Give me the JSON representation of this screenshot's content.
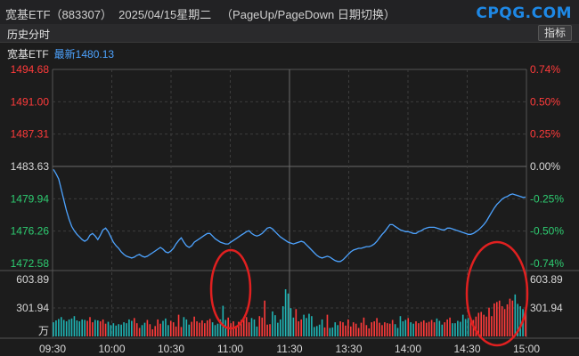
{
  "header": {
    "title": "宽基ETF（883307）  2025/04/15星期二   （PageUp/PageDown 日期切换）",
    "logo": "CPQG.COM"
  },
  "tabbar": {
    "tab_label": "历史分时",
    "indicator_button": "指标"
  },
  "info": {
    "name": "宽基ETF",
    "latest": "最新1480.13"
  },
  "colors": {
    "up": "#ff3b3b",
    "down": "#2ecc71",
    "neutral": "#d8d8d8",
    "line": "#4da3ff",
    "volume_down": "#1fb5b5",
    "annotation": "#e02020"
  },
  "chart_data": {
    "type": "line",
    "price_axis": {
      "left_labels": [
        "1494.68",
        "1491.00",
        "1487.31",
        "1483.63",
        "1479.94",
        "1476.26",
        "1472.58"
      ],
      "right_labels": [
        "0.74%",
        "0.50%",
        "0.25%",
        "0.00%",
        "-0.25%",
        "-0.50%",
        "-0.74%"
      ],
      "prev_close": 1483.63,
      "ylim": [
        1472.58,
        1494.68
      ]
    },
    "volume_axis": {
      "left_labels": [
        "603.89",
        "301.94",
        "万"
      ],
      "right_labels": [
        "603.89",
        "301.94"
      ],
      "ylim": [
        0,
        603.89
      ]
    },
    "time_labels": [
      "09:30",
      "10:00",
      "10:30",
      "11:00",
      "11:30",
      "13:30",
      "14:00",
      "14:30",
      "15:00"
    ],
    "series": [
      {
        "values": [
          1483.3,
          1482.8,
          1482.2,
          1481.0,
          1479.8,
          1478.6,
          1477.6,
          1476.8,
          1476.3,
          1475.9,
          1475.6,
          1475.3,
          1475.1,
          1475.3,
          1475.8,
          1476.0,
          1475.7,
          1475.3,
          1475.8,
          1476.4,
          1476.6,
          1476.2,
          1475.6,
          1475.0,
          1474.6,
          1474.3,
          1473.9,
          1473.6,
          1473.4,
          1473.3,
          1473.2,
          1473.3,
          1473.5,
          1473.6,
          1473.4,
          1473.3,
          1473.4,
          1473.6,
          1473.8,
          1474.0,
          1474.2,
          1474.4,
          1474.2,
          1473.9,
          1473.8,
          1474.0,
          1474.3,
          1474.8,
          1475.2,
          1475.5,
          1475.0,
          1474.6,
          1474.4,
          1474.6,
          1475.0,
          1475.2,
          1475.4,
          1475.6,
          1475.8,
          1476.0,
          1476.0,
          1475.7,
          1475.4,
          1475.2,
          1475.0,
          1474.9,
          1474.8,
          1474.8,
          1475.0,
          1475.2,
          1475.4,
          1475.6,
          1475.8,
          1476.0,
          1476.2,
          1476.3,
          1476.0,
          1475.8,
          1475.7,
          1475.8,
          1476.0,
          1476.3,
          1476.6,
          1476.7,
          1476.5,
          1476.2,
          1475.9,
          1475.6,
          1475.4,
          1475.2,
          1475.0,
          1474.9,
          1474.8,
          1474.9,
          1475.0,
          1475.1,
          1475.0,
          1474.7,
          1474.4,
          1474.1,
          1473.8,
          1473.5,
          1473.3,
          1473.2,
          1473.3,
          1473.4,
          1473.3,
          1473.1,
          1472.9,
          1472.8,
          1472.8,
          1473.0,
          1473.3,
          1473.6,
          1473.9,
          1474.1,
          1474.2,
          1474.3,
          1474.3,
          1474.4,
          1474.5,
          1474.5,
          1474.6,
          1474.8,
          1475.1,
          1475.5,
          1475.9,
          1476.2,
          1476.6,
          1477.0,
          1477.0,
          1476.8,
          1476.6,
          1476.4,
          1476.3,
          1476.2,
          1476.2,
          1476.1,
          1476.0,
          1476.0,
          1476.2,
          1476.3,
          1476.5,
          1476.6,
          1476.7,
          1476.7,
          1476.7,
          1476.6,
          1476.5,
          1476.4,
          1476.4,
          1476.6,
          1476.6,
          1476.5,
          1476.4,
          1476.3,
          1476.2,
          1476.1,
          1476.0,
          1475.9,
          1475.9,
          1476.0,
          1476.2,
          1476.4,
          1476.7,
          1477.0,
          1477.4,
          1477.9,
          1478.4,
          1478.9,
          1479.3,
          1479.6,
          1479.9,
          1480.1,
          1480.2,
          1480.4,
          1480.5,
          1480.4,
          1480.3,
          1480.2,
          1480.1,
          1480.13
        ],
        "volume": [
          150,
          170,
          185,
          205,
          175,
          160,
          180,
          190,
          215,
          170,
          160,
          180,
          175,
          165,
          205,
          150,
          175,
          170,
          160,
          180,
          135,
          155,
          120,
          140,
          115,
          130,
          125,
          150,
          140,
          180,
          165,
          195,
          140,
          90,
          120,
          145,
          175,
          130,
          75,
          110,
          180,
          135,
          165,
          190,
          120,
          165,
          150,
          105,
          230,
          100,
          205,
          180,
          125,
          155,
          210,
          160,
          145,
          170,
          140,
          170,
          185,
          150,
          120,
          135,
          180,
          325,
          175,
          200,
          140,
          160,
          110,
          155,
          175,
          180,
          205,
          150,
          195,
          180,
          105,
          215,
          200,
          380,
          125,
          130,
          265,
          225,
          145,
          180,
          320,
          500,
          455,
          300,
          200,
          290,
          160,
          180,
          230,
          195,
          240,
          215,
          100,
          110,
          125,
          180,
          95,
          230,
          90,
          95,
          150,
          120,
          160,
          150,
          115,
          180,
          105,
          150,
          135,
          90,
          145,
          200,
          120,
          85,
          150,
          160,
          195,
          145,
          120,
          150,
          140,
          135,
          175,
          130,
          90,
          215,
          160,
          175,
          195,
          150,
          135,
          160,
          140,
          155,
          170,
          145,
          155,
          175,
          150,
          190,
          165,
          125,
          150,
          180,
          200,
          140,
          140,
          165,
          155,
          230,
          185,
          195,
          200,
          175,
          210,
          250,
          260,
          230,
          210,
          305,
          215,
          350,
          365,
          380,
          320,
          290,
          340,
          400,
          380,
          445,
          345,
          320,
          290,
          260
        ]
      }
    ]
  }
}
